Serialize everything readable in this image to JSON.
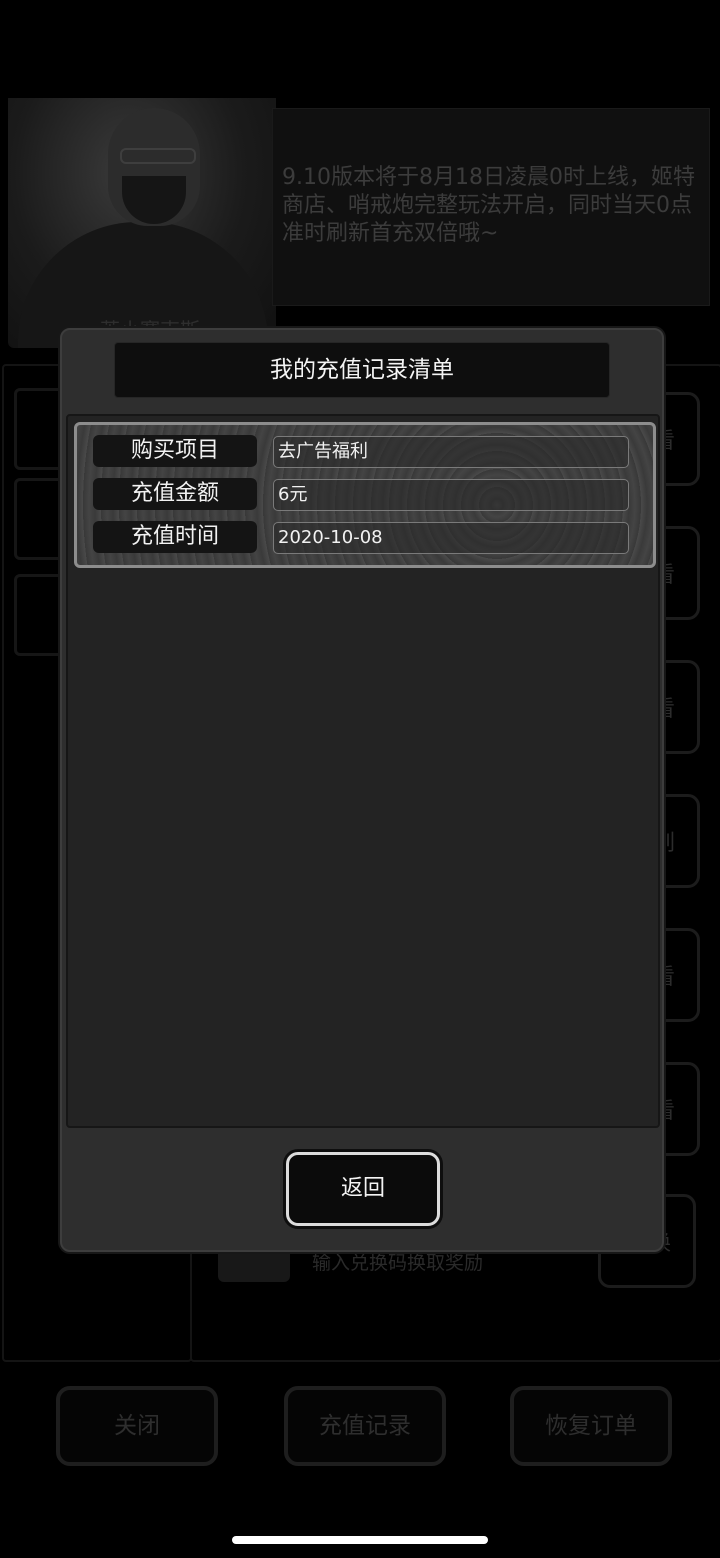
{
  "background": {
    "news_text": "9.10版本将于8月18日凌晨0时上线，姬特商店、哨戒炮完整玩法开启，同时当天0点准时刷新首充双倍哦~",
    "character_name": "莱小赛克斯",
    "side_buttons": [
      "看",
      "看",
      "看",
      "刷",
      "看",
      "看",
      "换"
    ],
    "redeem_text": "输入兑换码换取奖励",
    "bottom_buttons": {
      "close": "关闭",
      "recharge_history": "充值记录",
      "restore_order": "恢复订单"
    }
  },
  "modal": {
    "title": "我的充值记录清单",
    "record": {
      "item_label": "购买项目",
      "item_value": "去广告福利",
      "amount_label": "充值金额",
      "amount_value": "6元",
      "time_label": "充值时间",
      "time_value": "2020-10-08"
    },
    "back_label": "返回"
  }
}
